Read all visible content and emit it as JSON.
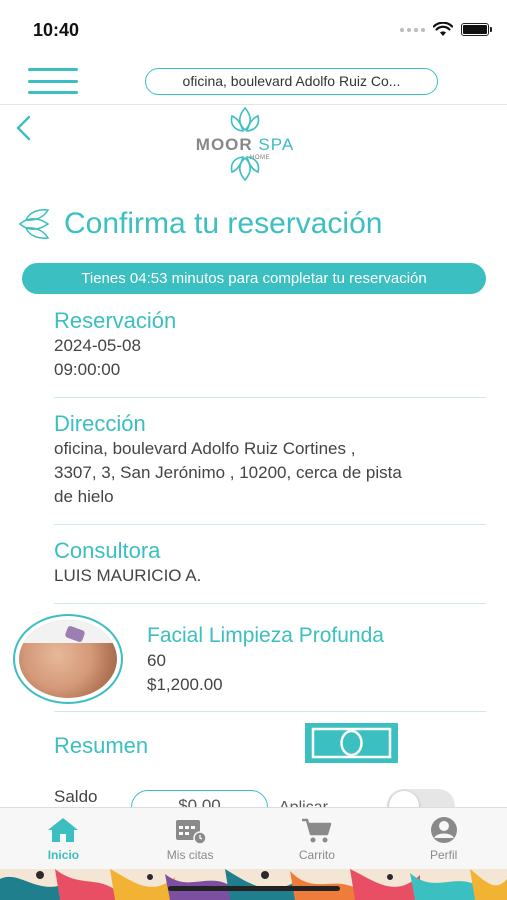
{
  "status": {
    "time": "10:40"
  },
  "header": {
    "address": "oficina, boulevard Adolfo Ruiz Co..."
  },
  "logo": {
    "word_main": "MOOR",
    "word_spa": "SPA",
    "word_home": "HOME"
  },
  "page": {
    "title": "Confirma tu reservación",
    "timer_text": "Tienes 04:53 minutos para completar tu reservación"
  },
  "reservation": {
    "heading": "Reservación",
    "date": "2024-05-08",
    "time": "09:00:00"
  },
  "address_section": {
    "heading": "Dirección",
    "line1": "oficina, boulevard Adolfo Ruiz Cortines ,",
    "line2": "3307, 3, San Jerónimo , 10200, cerca de pista",
    "line3": "de hielo"
  },
  "consultant": {
    "heading": "Consultora",
    "name": "LUIS MAURICIO A."
  },
  "service": {
    "name": "Facial Limpieza Profunda",
    "duration": "60",
    "price": "$1,200.00"
  },
  "summary": {
    "heading": "Resumen",
    "saldo_label": "Saldo",
    "saldo_value": "$0.00",
    "apply_label": "Aplicar"
  },
  "nav": {
    "items": [
      {
        "label": "Inicio",
        "icon": "home-icon",
        "active": true
      },
      {
        "label": "Mis citas",
        "icon": "calendar-icon",
        "active": false
      },
      {
        "label": "Carrito",
        "icon": "cart-icon",
        "active": false
      },
      {
        "label": "Perfil",
        "icon": "profile-icon",
        "active": false
      }
    ]
  },
  "colors": {
    "accent": "#3bbfc0",
    "muted": "#8a8a8a"
  }
}
